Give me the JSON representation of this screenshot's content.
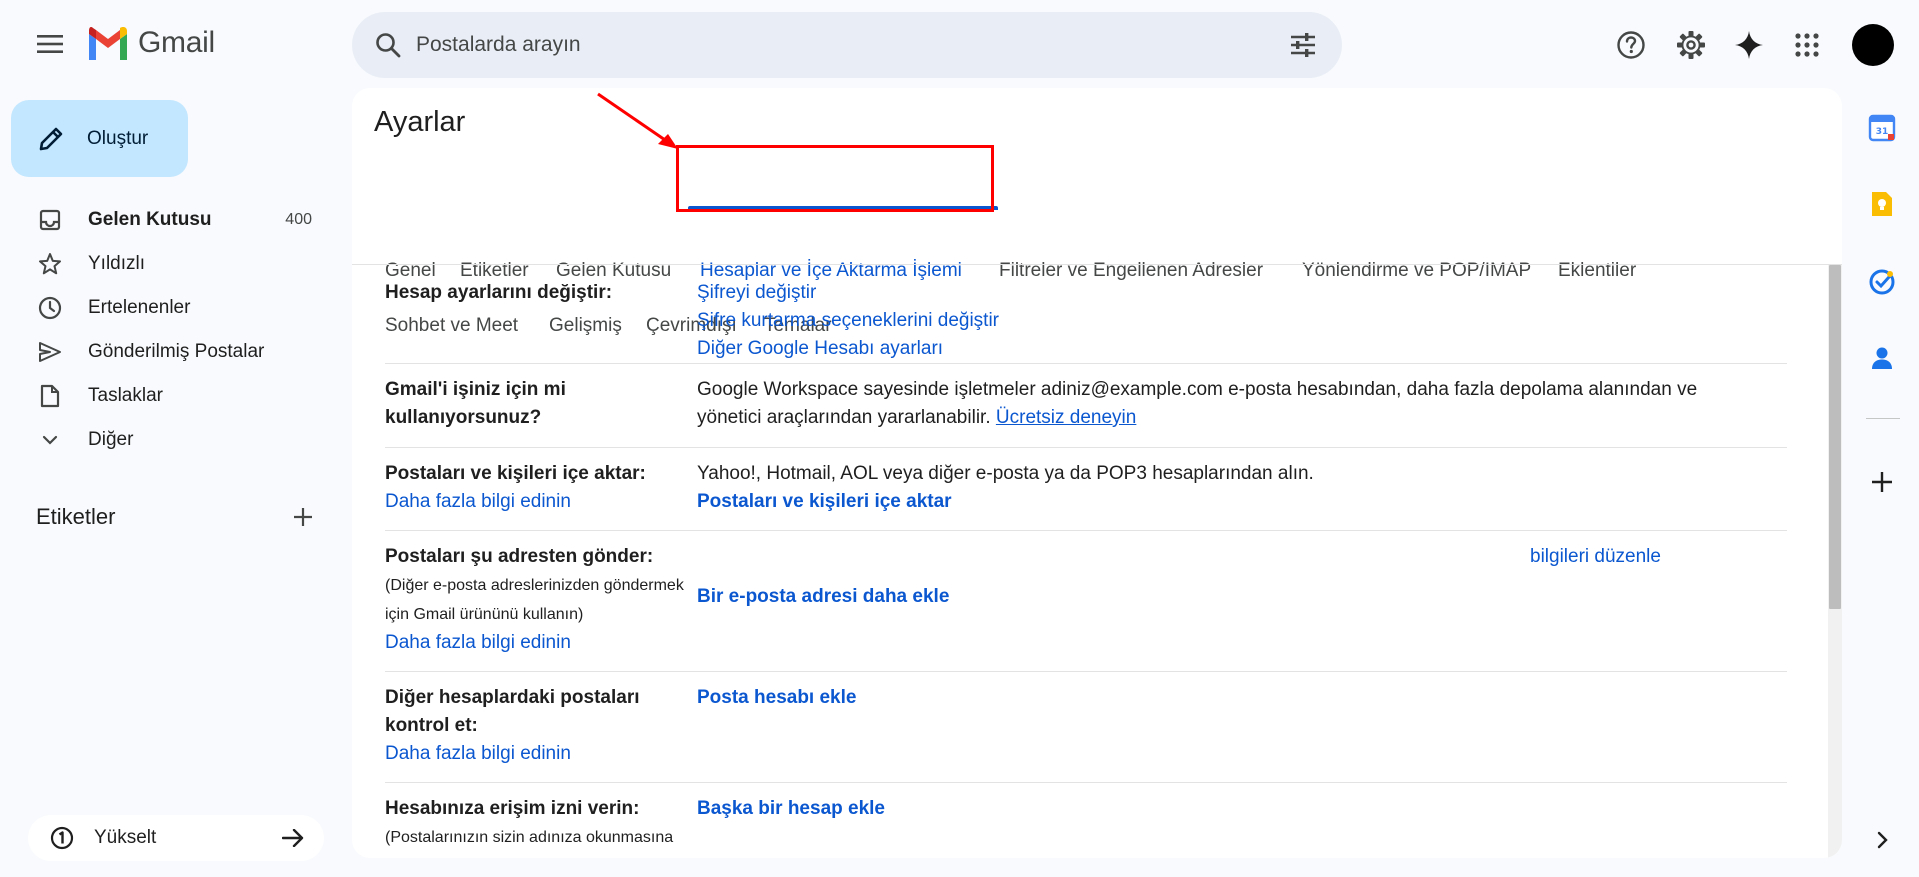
{
  "header": {
    "app_name": "Gmail",
    "search_placeholder": "Postalarda arayın"
  },
  "sidebar": {
    "compose_label": "Oluştur",
    "items": [
      {
        "label": "Gelen Kutusu",
        "count": "400",
        "icon": "inbox-icon",
        "bold": true
      },
      {
        "label": "Yıldızlı",
        "icon": "star-icon"
      },
      {
        "label": "Ertelenenler",
        "icon": "clock-icon"
      },
      {
        "label": "Gönderilmiş Postalar",
        "icon": "send-icon"
      },
      {
        "label": "Taslaklar",
        "icon": "draft-icon"
      },
      {
        "label": "Diğer",
        "icon": "chevron-down-icon"
      }
    ],
    "labels_title": "Etiketler",
    "upgrade_label": "Yükselt"
  },
  "settings": {
    "title": "Ayarlar",
    "tabs": [
      "Genel",
      "Etiketler",
      "Gelen Kutusu",
      "Hesaplar ve İçe Aktarma İşlemi",
      "Filtreler ve Engellenen Adresler",
      "Yönlendirme ve POP/IMAP",
      "Eklentiler",
      "Sohbet ve Meet",
      "Gelişmiş",
      "Çevrimdışı",
      "Temalar"
    ],
    "active_tab": "Hesaplar ve İçe Aktarma İşlemi",
    "rows": {
      "account": {
        "label": "Hesap ayarlarını değiştir:",
        "links": [
          "Şifreyi değiştir",
          "Şifre kurtarma seçeneklerini değiştir",
          "Diğer Google Hesabı ayarları"
        ]
      },
      "workspace": {
        "label": "Gmail'i işiniz için mi kullanıyorsunuz?",
        "text": "Google Workspace sayesinde işletmeler adiniz@example.com e-posta hesabından, daha fazla depolama alanından ve yönetici araçlarından yararlanabilir.",
        "link": "Ücretsiz deneyin"
      },
      "import": {
        "label": "Postaları ve kişileri içe aktar:",
        "learn_more": "Daha fazla bilgi edinin",
        "text": "Yahoo!, Hotmail, AOL veya diğer e-posta ya da POP3 hesaplarından alın.",
        "action": "Postaları ve kişileri içe aktar"
      },
      "send_as": {
        "label": "Postaları şu adresten gönder:",
        "sub": "(Diğer e-posta adreslerinizden göndermek için Gmail ürününü kullanın)",
        "learn_more": "Daha fazla bilgi edinin",
        "edit": "bilgileri düzenle",
        "action": "Bir e-posta adresi daha ekle"
      },
      "check_mail": {
        "label": "Diğer hesaplardaki postaları kontrol et:",
        "learn_more": "Daha fazla bilgi edinin",
        "action": "Posta hesabı ekle"
      },
      "grant_access": {
        "label": "Hesabınıza erişim izni verin:",
        "sub": "(Postalarınızın sizin adınıza okunmasına",
        "action": "Başka bir hesap ekle"
      }
    }
  },
  "colors": {
    "accent": "#0b57d0",
    "highlight": "#ff0000",
    "compose_bg": "#c2e7ff"
  }
}
